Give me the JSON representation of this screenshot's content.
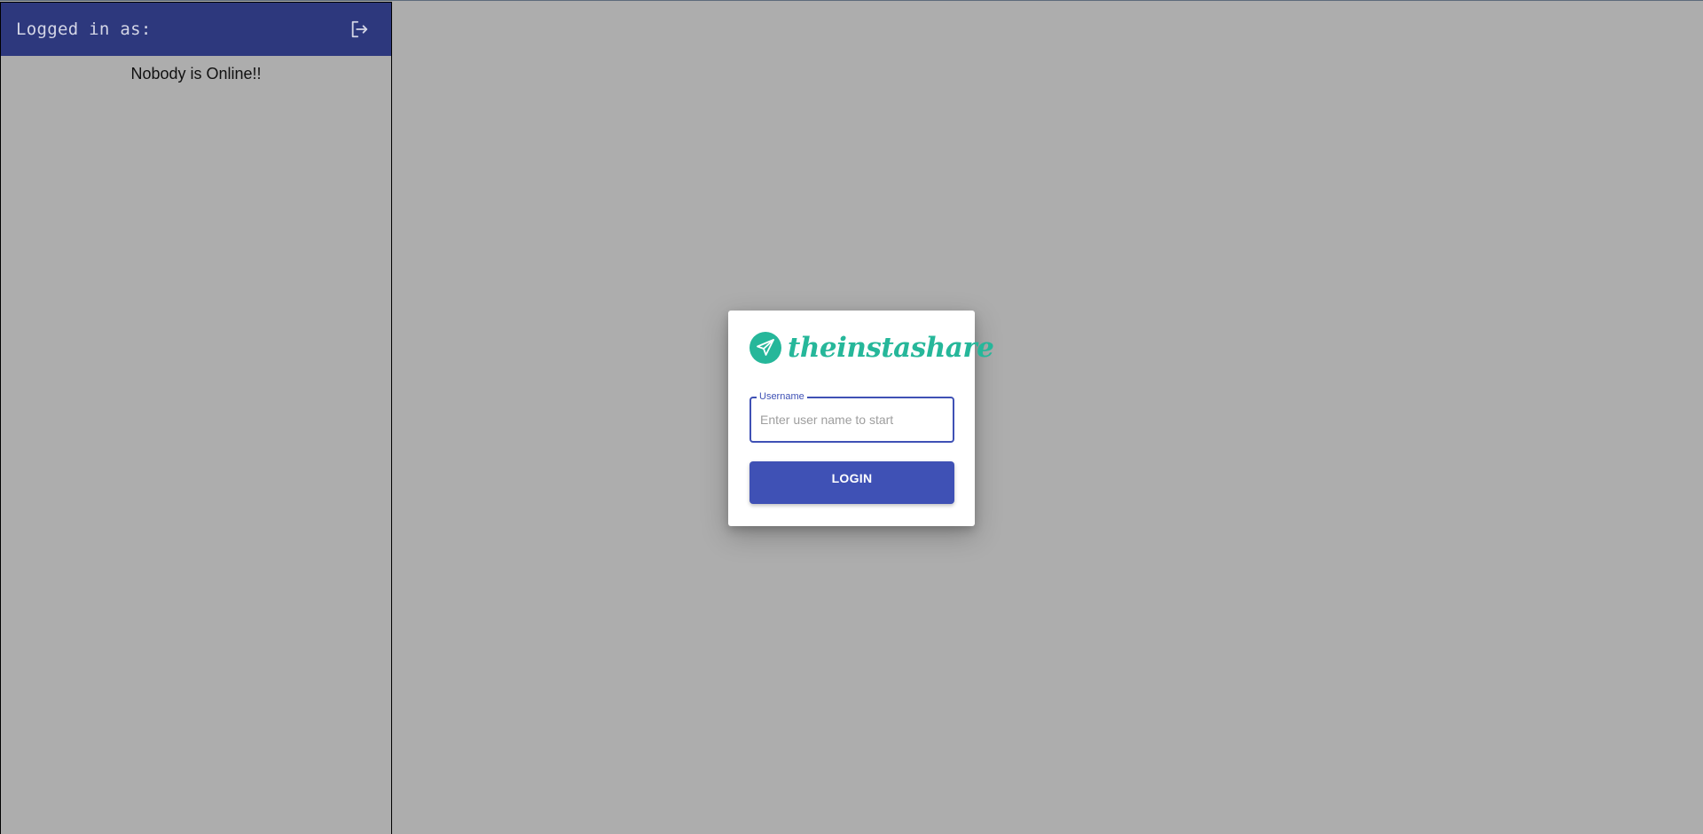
{
  "sidebar": {
    "header": {
      "logged_in_label": "Logged in as:",
      "logout_icon": "logout-icon"
    },
    "online_status": "Nobody is Online!!"
  },
  "login_card": {
    "logo": {
      "icon": "paper-plane-icon",
      "text": "theinstashare"
    },
    "username_field": {
      "label": "Username",
      "placeholder": "Enter user name to start",
      "value": ""
    },
    "login_button_label": "LOGIN"
  },
  "colors": {
    "header_bg": "#2d387d",
    "page_bg": "#adadad",
    "brand": "#26b79a",
    "primary": "#3f51b5"
  }
}
